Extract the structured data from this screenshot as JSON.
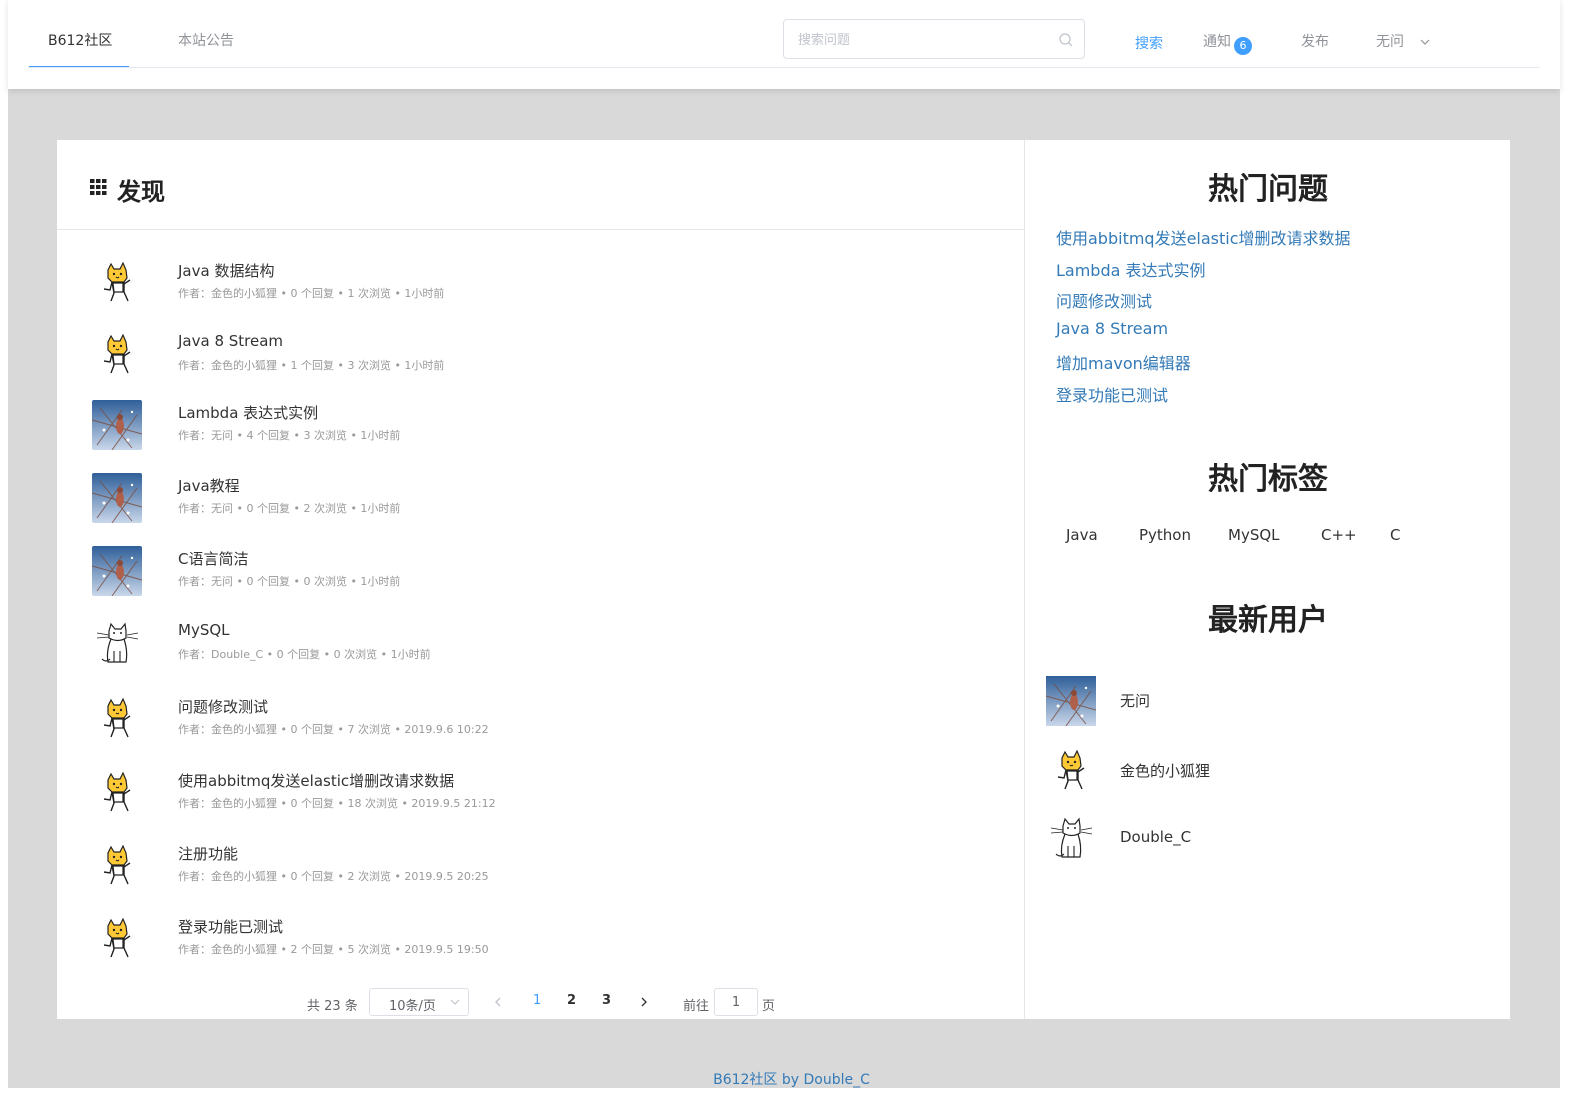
{
  "navbar": {
    "tabs": [
      {
        "label": "B612社区"
      },
      {
        "label": "本站公告"
      }
    ],
    "search": {
      "placeholder": "搜索问题",
      "value": ""
    },
    "search_button": "搜索",
    "notifications_label": "通知",
    "notifications_count": "6",
    "publish_label": "发布",
    "user_label": "无问"
  },
  "main": {
    "title": "发现",
    "questions": [
      {
        "title": "Java 数据结构",
        "meta": "作者：金色的小狐狸 • 0 个回复 • 1 次浏览 • 1小时前",
        "avatar": "fox"
      },
      {
        "title": "Java 8 Stream",
        "meta": "作者：金色的小狐狸 • 1 个回复 • 3 次浏览 • 1小时前",
        "avatar": "fox"
      },
      {
        "title": "Lambda 表达式实例",
        "meta": "作者：无问 • 4 个回复 • 3 次浏览 • 1小时前",
        "avatar": "bird"
      },
      {
        "title": "Java教程",
        "meta": "作者：无问 • 0 个回复 • 2 次浏览 • 1小时前",
        "avatar": "bird"
      },
      {
        "title": "C语言简洁",
        "meta": "作者：无问 • 0 个回复 • 0 次浏览 • 1小时前",
        "avatar": "bird"
      },
      {
        "title": "MySQL",
        "meta": "作者：Double_C • 0 个回复 • 0 次浏览 • 1小时前",
        "avatar": "cat"
      },
      {
        "title": "问题修改测试",
        "meta": "作者：金色的小狐狸 • 0 个回复 • 7 次浏览 • 2019.9.6 10:22",
        "avatar": "fox"
      },
      {
        "title": "使用abbitmq发送elastic增删改请求数据",
        "meta": "作者：金色的小狐狸 • 0 个回复 • 18 次浏览 • 2019.9.5 21:12",
        "avatar": "fox"
      },
      {
        "title": "注册功能",
        "meta": "作者：金色的小狐狸 • 0 个回复 • 2 次浏览 • 2019.9.5 20:25",
        "avatar": "fox"
      },
      {
        "title": "登录功能已测试",
        "meta": "作者：金色的小狐狸 • 2 个回复 • 5 次浏览 • 2019.9.5 19:50",
        "avatar": "fox"
      }
    ],
    "pagination": {
      "total_label": "共 23 条",
      "page_size_label": "10条/页",
      "pages": [
        "1",
        "2",
        "3"
      ],
      "current_page": "1",
      "goto_prefix": "前往",
      "goto_value": "1",
      "goto_suffix": "页"
    }
  },
  "sidebar": {
    "hot_questions_title": "热门问题",
    "hot_questions": [
      "使用abbitmq发送elastic增删改请求数据",
      "Lambda 表达式实例",
      "问题修改测试",
      "Java 8 Stream",
      "增加mavon编辑器",
      "登录功能已测试"
    ],
    "hot_tags_title": "热门标签",
    "hot_tags": [
      "Java",
      "Python",
      "MySQL",
      "C++",
      "C"
    ],
    "new_users_title": "最新用户",
    "new_users": [
      {
        "name": "无问",
        "avatar": "bird"
      },
      {
        "name": "金色的小狐狸",
        "avatar": "fox"
      },
      {
        "name": "Double_C",
        "avatar": "cat"
      }
    ]
  },
  "footer": {
    "text": "B612社区 by Double_C"
  },
  "colors": {
    "accent": "#409eff",
    "link": "#337ab7",
    "page_bg": "#d9d9d9"
  }
}
